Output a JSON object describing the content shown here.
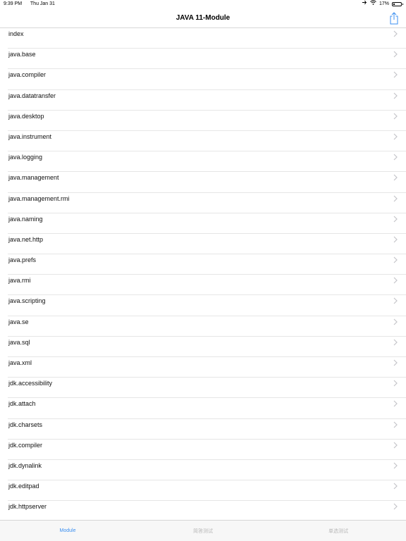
{
  "status_bar": {
    "time": "9:39 PM",
    "date": "Thu Jan 31",
    "battery": "17%",
    "battery_level": 0.17
  },
  "nav": {
    "title": "JAVA 11-Module"
  },
  "list": {
    "items": [
      "index",
      "java.base",
      "java.compiler",
      "java.datatransfer",
      "java.desktop",
      "java.instrument",
      "java.logging",
      "java.management",
      "java.management.rmi",
      "java.naming",
      "java.net.http",
      "java.prefs",
      "java.rmi",
      "java.scripting",
      "java.se",
      "java.sql",
      "java.xml",
      "jdk.accessibility",
      "jdk.attach",
      "jdk.charsets",
      "jdk.compiler",
      "jdk.dynalink",
      "jdk.editpad",
      "jdk.httpserver"
    ]
  },
  "tabs": [
    {
      "label": "Module",
      "active": true
    },
    {
      "label": "简答测试",
      "active": false
    },
    {
      "label": "单选测试",
      "active": false
    }
  ],
  "colors": {
    "accent": "#3b8ff0",
    "separator": "#e6e6e6",
    "chevron": "#c4c4c9"
  }
}
